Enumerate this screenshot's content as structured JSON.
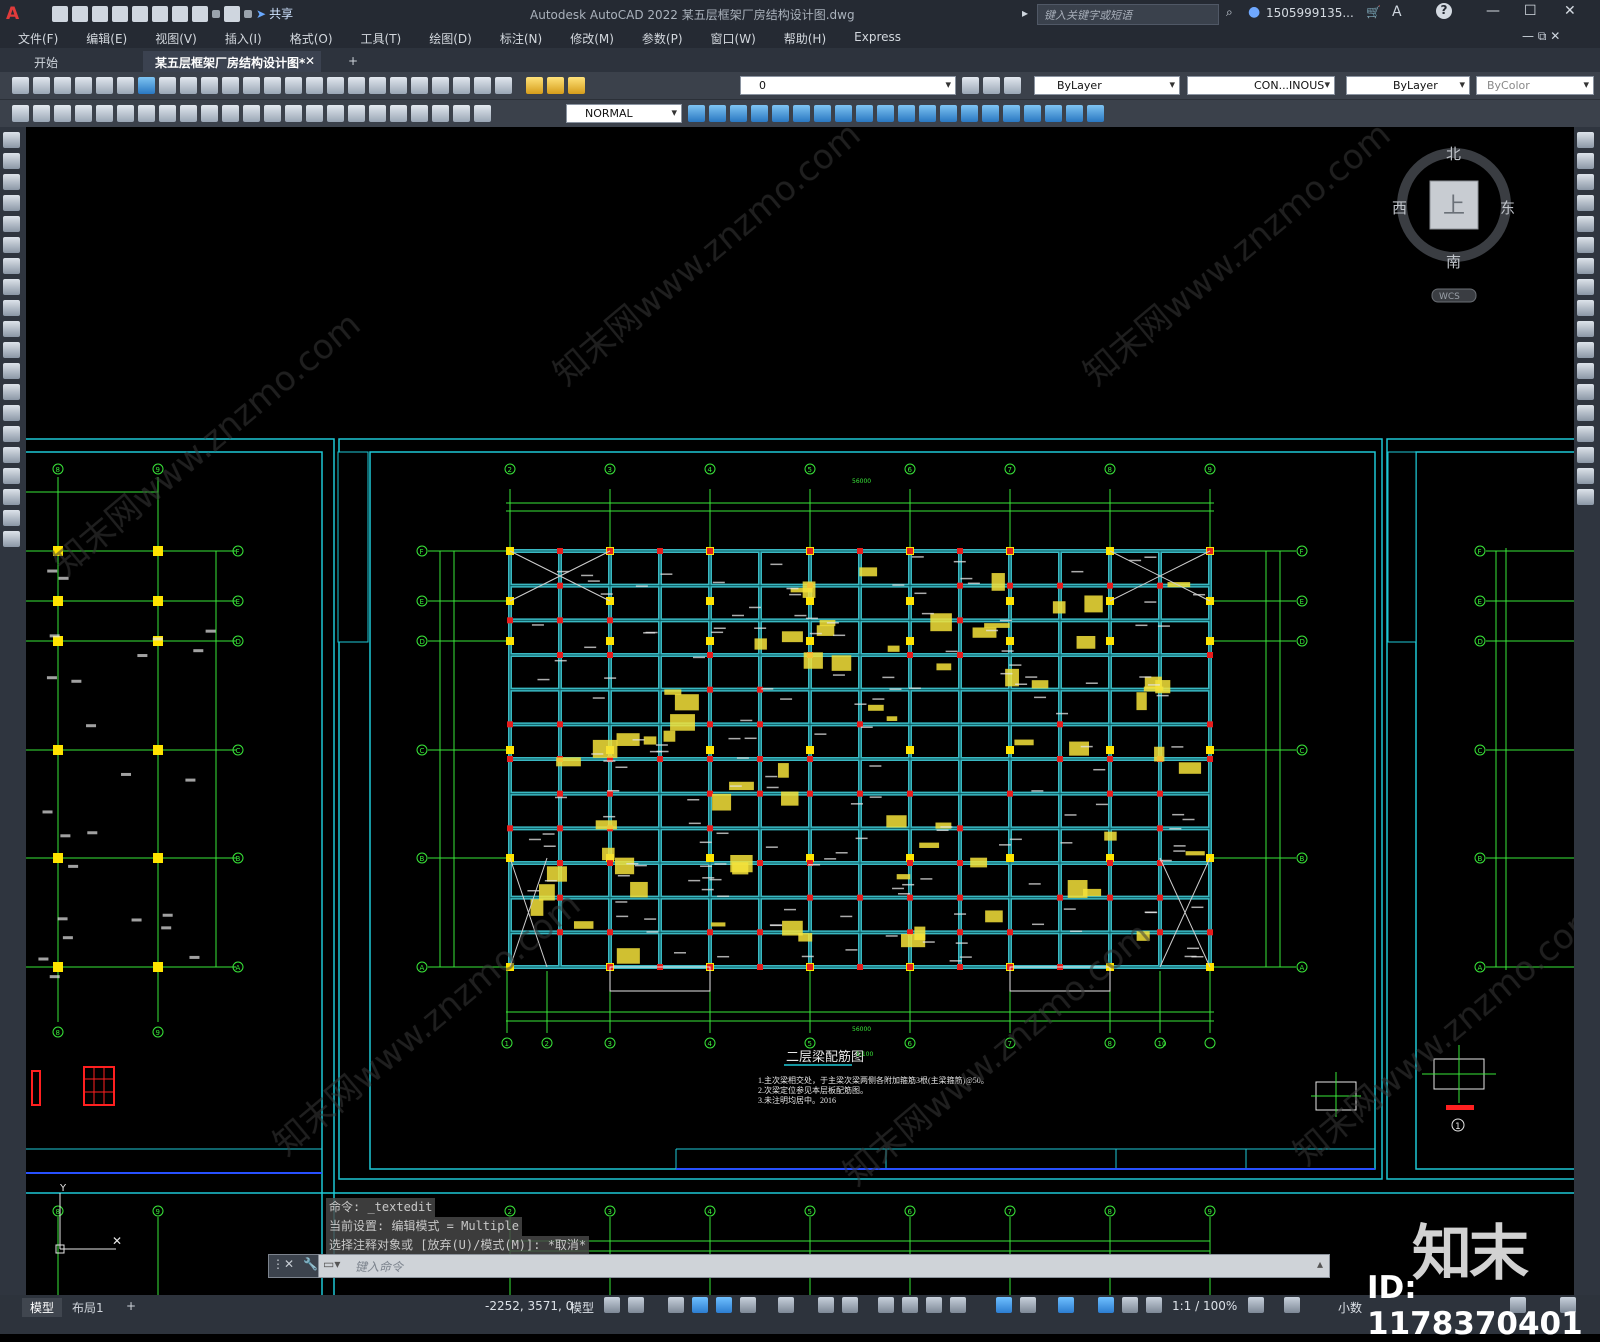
{
  "window": {
    "app_title": "Autodesk AutoCAD 2022    某五层框架厂房结构设计图.dwg",
    "share_label": "共享",
    "search_placeholder": "键入关键字或短语",
    "user": "1505999135...",
    "window_controls": [
      "—",
      "☐",
      "✕"
    ]
  },
  "menu": [
    "文件(F)",
    "编辑(E)",
    "视图(V)",
    "插入(I)",
    "格式(O)",
    "工具(T)",
    "绘图(D)",
    "标注(N)",
    "修改(M)",
    "参数(P)",
    "窗口(W)",
    "帮助(H)",
    "Express"
  ],
  "tabs": [
    {
      "label": "开始"
    },
    {
      "label": "某五层框架厂房结构设计图*"
    }
  ],
  "toolbar": {
    "layer_value": "0",
    "color_value": "ByLayer",
    "linetype_value": "CON...INOUS",
    "lineweight_value": "ByLayer",
    "plotstyle_value": "ByColor",
    "dimstyle_value": "NORMAL"
  },
  "viewcube": {
    "north": "北",
    "south": "南",
    "east": "东",
    "west": "西",
    "top_face": "上",
    "wcs": "WCS"
  },
  "drawing": {
    "main_title": "二层梁配筋图",
    "scale_note": "1:100",
    "notes": [
      "1.主次梁相交处，于主梁次梁两侧各附加箍筋3根(主梁箍筋)@50。",
      "2.次梁定位参见本层板配筋图。",
      "3.未注明均居中。2016"
    ],
    "top_axes": [
      "2",
      "3",
      "4",
      "5",
      "6",
      "7",
      "8",
      "9"
    ],
    "bottom_axes": [
      "1",
      "2",
      "3",
      "4",
      "5",
      "6",
      "7",
      "8",
      "10"
    ],
    "side_axes": [
      "F",
      "E",
      "D",
      "C",
      "B",
      "A"
    ],
    "left_axes": [
      "8",
      "9"
    ],
    "overall_dim": "56000",
    "detail_mark": "1"
  },
  "command": {
    "history": [
      "命令: _textedit",
      "当前设置: 编辑模式 = Multiple",
      "选择注释对象或 [放弃(U)/模式(M)]: *取消*"
    ],
    "placeholder": "键入命令"
  },
  "status": {
    "layout_tabs": [
      "模型",
      "布局1"
    ],
    "coords": "-2252, 3571, 0",
    "space": "模型",
    "scale": "1:1 / 100%",
    "units": "小数"
  },
  "watermark": {
    "brand": "知末",
    "id": "ID: 1178370401"
  }
}
